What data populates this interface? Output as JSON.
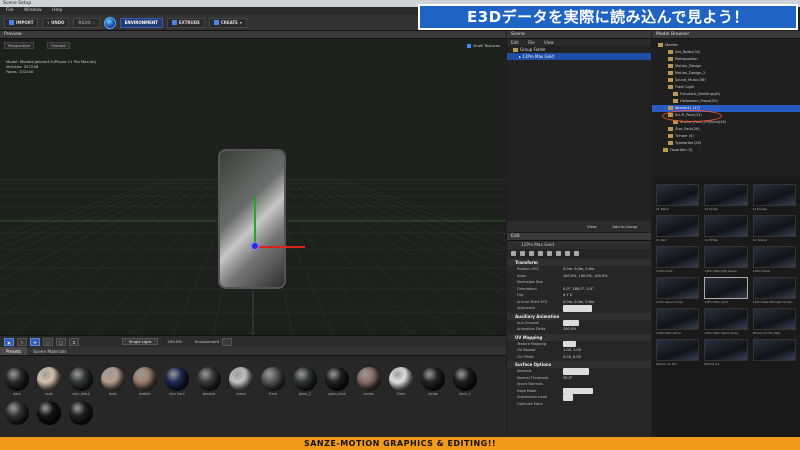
{
  "window": {
    "title": "Scene Setup"
  },
  "menu": [
    "File",
    "Window",
    "Help"
  ],
  "toolbar": {
    "import": "IMPORT",
    "undo": "UNDO",
    "redo": "REDO",
    "environment": "ENVIRONMENT",
    "extrude": "EXTRUDE",
    "create": "CREATE"
  },
  "banner": "E3Dデータを実際に読み込んで見よう！",
  "preview": {
    "title": "Preview",
    "view_mode": "Perspective",
    "shade_mode": "Shaded",
    "model_label": "Model:",
    "model_path": "Models\\iphone11\\iPhone 11 Pro Max.obj",
    "vertices_label": "Vertices:",
    "vertices": "307248",
    "faces_label": "Faces:",
    "faces": "102440",
    "draft_textures": "Draft Textures"
  },
  "viewport_bar": {
    "light": "Single Light",
    "zoom": "100.0%",
    "environment_label": "Environment"
  },
  "presets": {
    "tabs": [
      "Presets",
      "Scene Materials"
    ],
    "materials": [
      {
        "name": "dark",
        "color": "#2b2b2b"
      },
      {
        "name": "bulb",
        "color": "#d6c4b0"
      },
      {
        "name": "carv_black",
        "color": "#333936"
      },
      {
        "name": "body",
        "color": "#b8a090"
      },
      {
        "name": "metalic",
        "color": "#a08070"
      },
      {
        "name": "lens front",
        "color": "#1c2a55"
      },
      {
        "name": "speaker",
        "color": "#3a3a3a"
      },
      {
        "name": "metal",
        "color": "#c4c4c4"
      },
      {
        "name": "Front",
        "color": "#555555"
      },
      {
        "name": "glass_2",
        "color": "#2f3836"
      },
      {
        "name": "glass_blue",
        "color": "#202124"
      },
      {
        "name": "screen",
        "color": "#8a6e66"
      },
      {
        "name": "Flash",
        "color": "#e4e4e4"
      },
      {
        "name": "stripe",
        "color": "#242424"
      },
      {
        "name": "back_c",
        "color": "#1e1e1e"
      },
      {
        "name": "",
        "color": "#303230"
      },
      {
        "name": "",
        "color": "#151515"
      },
      {
        "name": "",
        "color": "#1f1f1f"
      }
    ]
  },
  "scene": {
    "title": "Scene",
    "menu": [
      "Edit",
      "File",
      "View"
    ],
    "rows": [
      {
        "label": "Group Folder"
      },
      {
        "label": "11Pro Max Gold"
      }
    ],
    "view_label": "View:",
    "add_to_group": "Add to Group"
  },
  "edit": {
    "title": "Edit",
    "object": "11Pro Max Gold",
    "sections": [
      {
        "title": "Transform",
        "rows": [
          {
            "k": "Position XYZ",
            "v": "0.0m, 0.0m, 0.0m"
          },
          {
            "k": "Scale",
            "v": "100.0%, 100.0%, 100.0%"
          },
          {
            "k": "Normalize Size",
            "v": ""
          },
          {
            "k": "Orientation",
            "v": "0.0°, 180.0°, 0.0°"
          },
          {
            "k": "Flip",
            "v": "X  Y  Z"
          },
          {
            "k": "Anchor Point XYZ",
            "v": "0.0m, 0.0m, 0.0m"
          },
          {
            "k": "Alignment",
            "v": "Model Center"
          }
        ]
      },
      {
        "title": "Auxiliary Animation",
        "rows": [
          {
            "k": "Aux Channel",
            "v": "None"
          },
          {
            "k": "Animation Delta",
            "v": "100.0%"
          }
        ]
      },
      {
        "title": "UV Mapping",
        "rows": [
          {
            "k": "Texture Mapping",
            "v": "UV"
          },
          {
            "k": "UV Repeat",
            "v": "1.00, 1.00"
          },
          {
            "k": "UV Offset",
            "v": "0.00, 0.00"
          }
        ]
      },
      {
        "title": "Surface Options",
        "rows": [
          {
            "k": "Normals",
            "v": "From Model"
          },
          {
            "k": "Normal Threshold",
            "v": "30.0°"
          },
          {
            "k": "Invert Normals",
            "v": ""
          },
          {
            "k": "Edge Mode",
            "v": "Disconnected"
          },
          {
            "k": "Subdivision Level",
            "v": "0"
          },
          {
            "k": "Optimize Mesh",
            "v": ""
          }
        ]
      }
    ]
  },
  "browser": {
    "title": "Model Browser",
    "tree": [
      {
        "label": "Models",
        "indent": 0
      },
      {
        "label": "Set_Notes(34)",
        "indent": 2
      },
      {
        "label": "Metropolitan",
        "indent": 2
      },
      {
        "label": "Motion_Design",
        "indent": 2
      },
      {
        "label": "Motion_Design_2",
        "indent": 2
      },
      {
        "label": "Sound_Music(58)",
        "indent": 2
      },
      {
        "label": "Flash Light",
        "indent": 2
      },
      {
        "label": "Futuristic_Buildings(8)",
        "indent": 3
      },
      {
        "label": "Halloween_Props(29)",
        "indent": 3
      },
      {
        "label": "iphone11 (17)",
        "indent": 2,
        "sel": true
      },
      {
        "label": "Sci-Fi_Pack(15)",
        "indent": 2
      },
      {
        "label": "Starter_Pack_Physical(40)",
        "indent": 3
      },
      {
        "label": "Star_Pack(26)",
        "indent": 2
      },
      {
        "label": "Timber (4)",
        "indent": 2
      },
      {
        "label": "Typewriter(26)",
        "indent": 2
      },
      {
        "label": "Favorites (3)",
        "indent": 1
      }
    ],
    "thumbs": [
      "11 Black",
      "11 Green",
      "11 Purple",
      "11 Red",
      "11 White",
      "11 Yellow",
      "11Pro Gold",
      "11Pro Midnight Green",
      "11Pro Silver",
      "11Pro Space Gray",
      "11Pro Max Gold",
      "11Pro Max Midnight Green",
      "11Pro Max Silver",
      "11Pro Max Space Gray",
      "iPhone 11 Pro Max",
      "iPhone 11 Pro",
      "iPhone 11",
      ""
    ]
  },
  "footer": "SANZE-MOTION GRAPHICS & EDITING!!"
}
